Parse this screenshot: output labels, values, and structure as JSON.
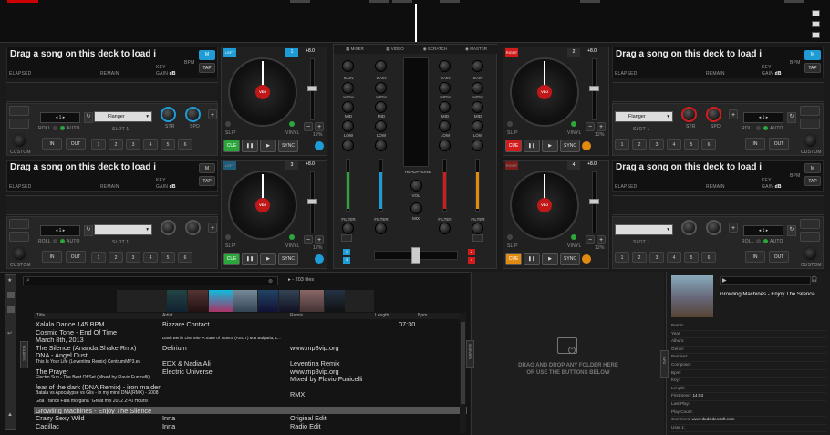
{
  "decks": [
    {
      "id": "deck-1",
      "title": "Drag a song on this deck to load i",
      "num": "1",
      "label": "LEFT",
      "pitch": "+8.0",
      "elapsed": "ELAPSED",
      "remain": "REMAIN",
      "bpm": "BPM",
      "key": "KEY",
      "gain": "GAIN",
      "gain_unit": "dB",
      "tap": "TAP",
      "m": "M",
      "effect": "Flanger",
      "slot": "SLOT 1",
      "str": "STR",
      "spd": "SPD",
      "roll": "ROLL",
      "auto": "AUTO",
      "in": "IN",
      "out": "OUT",
      "custom": "CUSTOM",
      "cue": "CUE",
      "sync": "SYNC",
      "slip": "SLIP",
      "vinyl": "VINYL",
      "pct": "12%",
      "loop": "1",
      "cue_color": "green",
      "accent": "blue"
    },
    {
      "id": "deck-2",
      "title": "Drag a song on this deck to load i",
      "num": "2",
      "label": "RIGHT",
      "pitch": "+8.0",
      "elapsed": "ELAPSED",
      "remain": "REMAIN",
      "bpm": "BPM",
      "key": "KEY",
      "gain": "GAIN",
      "gain_unit": "dB",
      "tap": "TAP",
      "m": "M",
      "effect": "Flanger",
      "slot": "SLOT 1",
      "str": "STR",
      "spd": "SPD",
      "roll": "ROLL",
      "auto": "AUTO",
      "in": "IN",
      "out": "OUT",
      "custom": "CUSTOM",
      "cue": "CUE",
      "sync": "SYNC",
      "slip": "SLIP",
      "vinyl": "VINYL",
      "pct": "12%",
      "loop": "1",
      "cue_color": "red",
      "accent": "red"
    },
    {
      "id": "deck-3",
      "title": "Drag a song on this deck to load i",
      "num": "3",
      "label": "LEFT",
      "pitch": "+8.0",
      "elapsed": "ELAPSED",
      "remain": "REMAIN",
      "bpm": "",
      "key": "KEY",
      "gain": "GAIN",
      "gain_unit": "dB",
      "tap": "TAP",
      "m": "M",
      "effect": "",
      "slot": "SLOT 1",
      "str": "",
      "spd": "",
      "roll": "ROLL",
      "auto": "AUTO",
      "in": "IN",
      "out": "OUT",
      "custom": "CUSTOM",
      "cue": "CUE",
      "sync": "SYNC",
      "slip": "SLIP",
      "vinyl": "VINYL",
      "pct": "12%",
      "loop": "1",
      "cue_color": "green",
      "accent": "grey"
    },
    {
      "id": "deck-4",
      "title": "Drag a song on this deck to load i",
      "num": "4",
      "label": "RIGHT",
      "pitch": "+8.0",
      "elapsed": "ELAPSED",
      "remain": "REMAIN",
      "bpm": "BPM",
      "key": "KEY",
      "gain": "GAIN",
      "gain_unit": "dB",
      "tap": "TAP",
      "m": "M",
      "effect": "",
      "slot": "SLOT 1",
      "str": "",
      "spd": "",
      "roll": "ROLL",
      "auto": "AUTO",
      "in": "IN",
      "out": "OUT",
      "custom": "CUSTOM",
      "cue": "CUE",
      "sync": "SYNC",
      "slip": "SLIP",
      "vinyl": "VINYL",
      "pct": "12%",
      "loop": "1",
      "cue_color": "orange",
      "accent": "grey"
    }
  ],
  "pads": [
    "1",
    "2",
    "3",
    "4",
    "5",
    "6"
  ],
  "mixer": {
    "tabs": [
      "MIXER",
      "VIDEO",
      "SCRATCH",
      "MASTER"
    ],
    "knob_labels": [
      "GAIN",
      "HIGH",
      "MID",
      "LOW"
    ],
    "filter": "FILTER",
    "headphone": "HEADPHONE",
    "vol": "VOL",
    "mix": "MIX",
    "ch_left_1": "1",
    "ch_left_3": "3",
    "ch_right_2": "2",
    "ch_right_4": "4"
  },
  "browser": {
    "search_placeholder": "",
    "file_count": "203 files",
    "columns": [
      "Title",
      "Artist",
      "Remix",
      "Length",
      "Bpm"
    ],
    "rows": [
      {
        "title": "Xalala Dance 145 BPM",
        "artist": "Bizzare Contact",
        "remix": "",
        "length": "07:30"
      },
      {
        "title": "Cosmic Tone - End Of Time",
        "artist": "",
        "remix": "",
        "length": ""
      },
      {
        "title": "March 8th, 2013",
        "artist": "Dash Berlin Live Mix- A State of Trance (ASOT) 606 Bulgaria, 1...",
        "remix": "",
        "length": ""
      },
      {
        "title": "The Silence (Ananda Shake Rmx)",
        "artist": "Delirium",
        "remix": "www.mp3vip.org",
        "length": ""
      },
      {
        "title": "DNA - Angel Dust",
        "artist": "",
        "remix": "",
        "length": ""
      },
      {
        "title": "This Is Your Life (Leventina Remix) CentrumMP3.eu",
        "artist": "EDX & Nadia Ali",
        "remix": "Leventina Remix",
        "length": ""
      },
      {
        "title": "The Prayer",
        "artist": "Electric Universe",
        "remix": "www.mp3vip.org",
        "length": ""
      },
      {
        "title": "Electro Sun - The Best Of Set (Mixed by Flavio Funicelli)",
        "artist": "",
        "remix": "Mixed by Flavio Funicelli",
        "length": ""
      },
      {
        "title": "fear of the dark (DNA Remix) - iron maiden",
        "artist": "",
        "remix": "",
        "length": ""
      },
      {
        "title": "Batala vs Apocalypse vs Glis - in my mind DNA(RMX) - 2008",
        "artist": "",
        "remix": "RMX",
        "length": ""
      },
      {
        "title": "Goa Trance Fata morgana \"Great mix 2012 2:40 Hours\\",
        "artist": "",
        "remix": "",
        "length": ""
      },
      {
        "title": "Growling Machines - Enjoy The Silence",
        "artist": "",
        "remix": "",
        "length": "",
        "selected": true
      },
      {
        "title": "Crazy Sexy Wild",
        "artist": "Inna",
        "remix": "Original Edit",
        "length": ""
      },
      {
        "title": "Cadillac",
        "artist": "Inna",
        "remix": "Radio Edit",
        "length": ""
      }
    ]
  },
  "dropzone": {
    "line1": "DRAG AND DROP ANY FOLDER HERE",
    "line2": "OR USE THE BUTTONS BELOW"
  },
  "side_tabs": {
    "left": "FOLDERS",
    "mid": "SIDEVIEW",
    "info": "INFO"
  },
  "info": {
    "track": "Growling Machines - Enjoy The Silence",
    "fields": [
      {
        "k": "Remix:",
        "v": ""
      },
      {
        "k": "Year:",
        "v": ""
      },
      {
        "k": "Album:",
        "v": ""
      },
      {
        "k": "Genre:",
        "v": ""
      },
      {
        "k": "Remixer:",
        "v": ""
      },
      {
        "k": "Composer:",
        "v": ""
      },
      {
        "k": "Bpm:",
        "v": ""
      },
      {
        "k": "Key:",
        "v": ""
      },
      {
        "k": "Length:",
        "v": ""
      },
      {
        "k": "First Seen:",
        "v": "14:53"
      },
      {
        "k": "Last Play:",
        "v": ""
      },
      {
        "k": "Play Count:",
        "v": ""
      },
      {
        "k": "Comment:",
        "v": "www.dadsideosoft.com"
      },
      {
        "k": "User 1:",
        "v": ""
      }
    ]
  },
  "colors": {
    "blue": "#1f9bd6",
    "red": "#d21c1c",
    "green": "#2aa63a",
    "orange": "#e08a10"
  }
}
